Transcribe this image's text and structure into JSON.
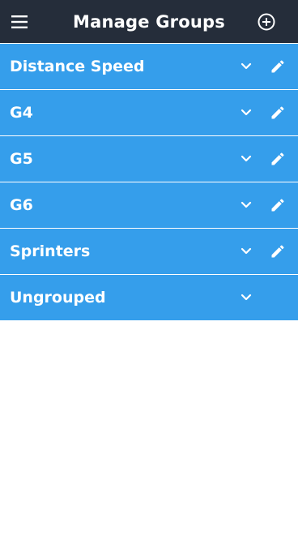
{
  "header": {
    "title": "Manage Groups",
    "menu_icon": "hamburger-menu-icon",
    "add_icon": "add-circle-icon"
  },
  "groups": [
    {
      "label": "Distance Speed",
      "expand_icon": "chevron-down-icon",
      "edit_icon": "pencil-icon",
      "editable": true
    },
    {
      "label": "G4",
      "expand_icon": "chevron-down-icon",
      "edit_icon": "pencil-icon",
      "editable": true
    },
    {
      "label": "G5",
      "expand_icon": "chevron-down-icon",
      "edit_icon": "pencil-icon",
      "editable": true
    },
    {
      "label": "G6",
      "expand_icon": "chevron-down-icon",
      "edit_icon": "pencil-icon",
      "editable": true
    },
    {
      "label": "Sprinters",
      "expand_icon": "chevron-down-icon",
      "edit_icon": "pencil-icon",
      "editable": true
    },
    {
      "label": "Ungrouped",
      "expand_icon": "chevron-down-icon",
      "editable": false
    }
  ],
  "colors": {
    "header_bg": "#252d3a",
    "row_bg": "#359eeb",
    "text": "#ffffff",
    "page_bg": "#ffffff"
  }
}
